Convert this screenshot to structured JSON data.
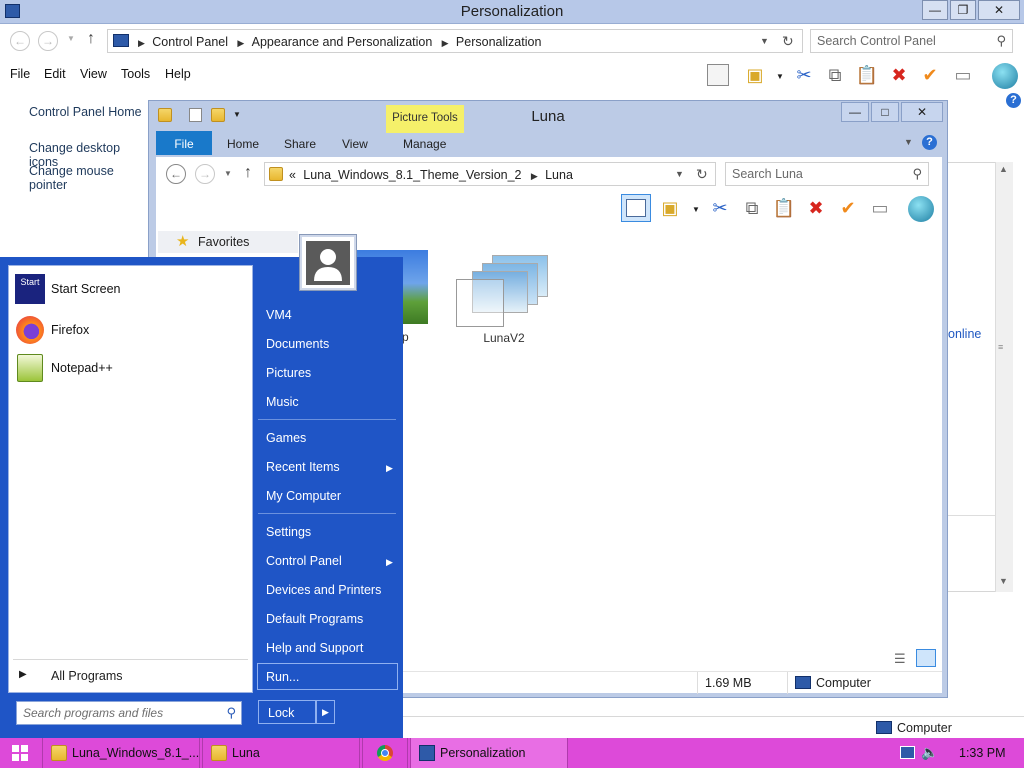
{
  "cp_window": {
    "title": "Personalization",
    "breadcrumbs": [
      "Control Panel",
      "Appearance and Personalization",
      "Personalization"
    ],
    "search_placeholder": "Search Control Panel",
    "menu": [
      "File",
      "Edit",
      "View",
      "Tools",
      "Help"
    ],
    "left_links": [
      "Control Panel Home",
      "Change desktop icons",
      "Change mouse pointer"
    ],
    "partial_link": "online",
    "status_computer": "Computer"
  },
  "luna_window": {
    "title": "Luna",
    "ribbon_tabs": [
      "File",
      "Home",
      "Share",
      "View"
    ],
    "context_group": "Picture Tools",
    "context_tab": "Manage",
    "path_prefix": "«",
    "breadcrumbs": [
      "Luna_Windows_8.1_Theme_Version_2",
      "Luna"
    ],
    "search_placeholder": "Search Luna",
    "nav_favorites": "Favorites",
    "items": [
      {
        "label": "Luna.bmp"
      },
      {
        "label": "LunaV2"
      }
    ],
    "status_size": "1.69 MB",
    "status_location": "Computer"
  },
  "start_menu": {
    "pinned": [
      {
        "label": "Start Screen",
        "icon": "start-screen-icon"
      },
      {
        "label": "Firefox",
        "icon": "firefox-icon"
      },
      {
        "label": "Notepad++",
        "icon": "notepadpp-icon"
      }
    ],
    "start_icon_text": "Start",
    "all_programs": "All Programs",
    "search_placeholder": "Search programs and files",
    "right_items": [
      {
        "label": "VM4"
      },
      {
        "label": "Documents"
      },
      {
        "label": "Pictures"
      },
      {
        "label": "Music"
      },
      {
        "label": "Games"
      },
      {
        "label": "Recent Items",
        "submenu": true
      },
      {
        "label": "My Computer"
      },
      {
        "label": "Settings"
      },
      {
        "label": "Control Panel",
        "submenu": true
      },
      {
        "label": "Devices and Printers"
      },
      {
        "label": "Default Programs"
      },
      {
        "label": "Help and Support"
      }
    ],
    "run": "Run...",
    "lock": "Lock"
  },
  "taskbar": {
    "tasks": [
      {
        "label": "Luna_Windows_8.1_...",
        "icon": "folder-icon"
      },
      {
        "label": "Luna",
        "icon": "folder-icon"
      },
      {
        "label": "",
        "icon": "chrome-icon"
      },
      {
        "label": "Personalization",
        "icon": "control-panel-icon"
      }
    ],
    "clock": "1:33 PM"
  },
  "colors": {
    "taskbar": "#dd4ad9",
    "start_menu": "#1f55c6",
    "file_tab": "#1979ca",
    "picture_tools": "#f5f06a"
  }
}
